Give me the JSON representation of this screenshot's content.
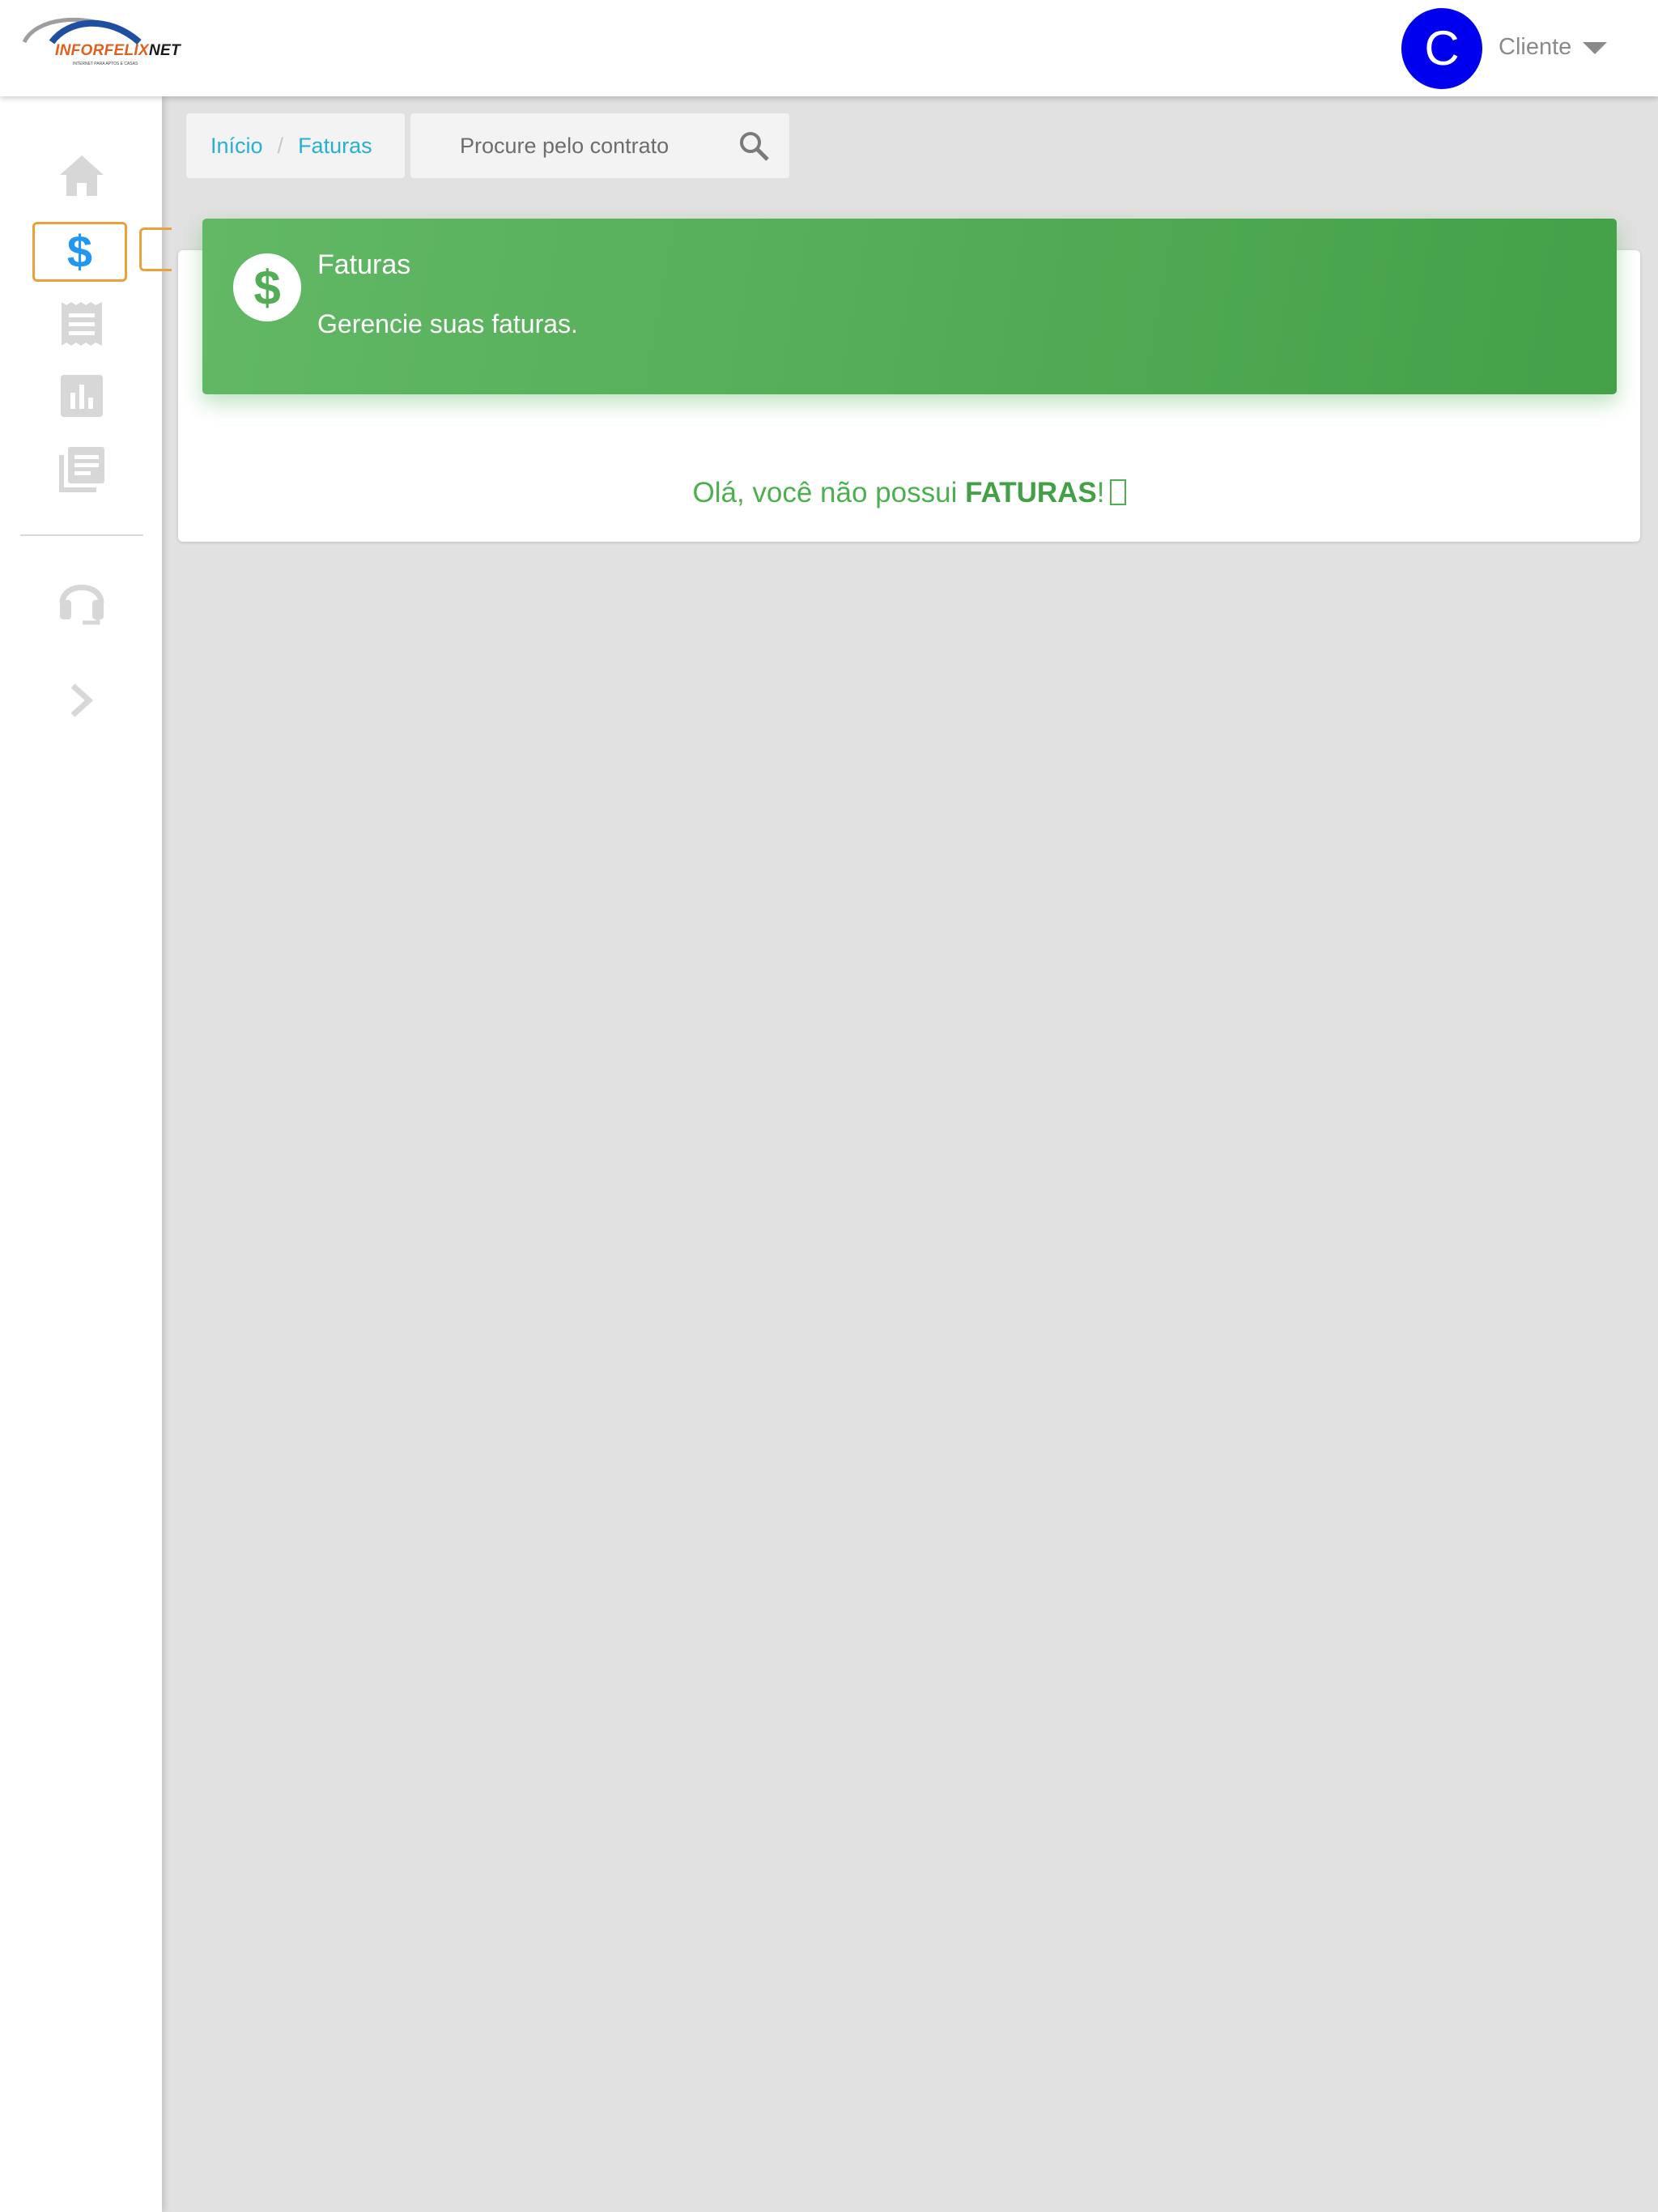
{
  "header": {
    "logo_text": "INFORFELIX",
    "logo_text_suffix": "NET",
    "logo_tagline": "INTERNET PARA APTOS E CASAS",
    "avatar_letter": "C",
    "user_name": "Cliente"
  },
  "sidebar": {
    "items": [
      {
        "name": "home",
        "icon": "home-icon"
      },
      {
        "name": "faturas",
        "icon": "dollar-icon",
        "label": "$",
        "selected": true
      },
      {
        "name": "receipt",
        "icon": "receipt-icon"
      },
      {
        "name": "reports",
        "icon": "bar-chart-icon"
      },
      {
        "name": "library",
        "icon": "library-books-icon"
      },
      {
        "name": "support",
        "icon": "headset-icon"
      },
      {
        "name": "expand",
        "icon": "chevron-right-icon"
      }
    ]
  },
  "breadcrumb": {
    "home": "Início",
    "separator": "/",
    "current": "Faturas"
  },
  "search": {
    "placeholder": "Procure pelo contrato"
  },
  "card": {
    "title": "Faturas",
    "subtitle": "Gerencie suas faturas.",
    "empty_prefix": "Olá, você não possui ",
    "empty_bold": "FATURAS",
    "empty_suffix": "!"
  },
  "colors": {
    "accent_green": "#4caf50",
    "link_blue": "#26b0d4",
    "avatar_blue": "#0000ee",
    "selected_outline": "#e9a23b",
    "selected_icon": "#2196f3"
  }
}
